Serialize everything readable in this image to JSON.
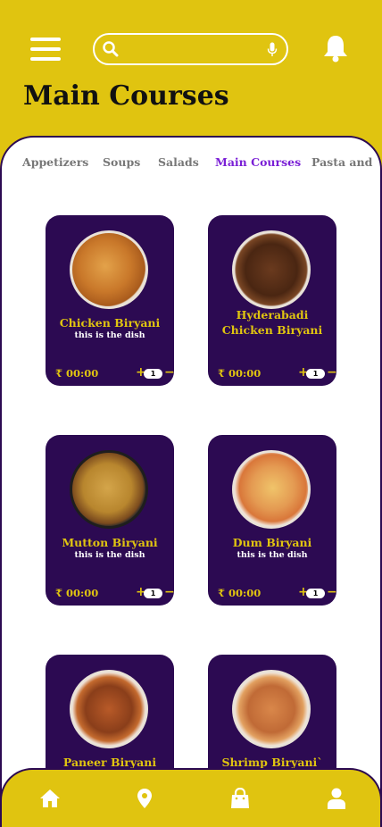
{
  "header": {
    "title": "Main Courses",
    "search_placeholder": ""
  },
  "icons": {
    "menu": "menu-icon",
    "search": "search-icon",
    "mic": "mic-icon",
    "bell": "bell-icon",
    "home": "home-icon",
    "location": "location-pin-icon",
    "cart": "shopping-bag-icon",
    "profile": "user-icon"
  },
  "tabs": [
    {
      "label": "Appetizers",
      "active": false
    },
    {
      "label": "Soups",
      "active": false
    },
    {
      "label": "Salads",
      "active": false
    },
    {
      "label": "Main Courses",
      "active": true
    },
    {
      "label": "Pasta and N",
      "active": false
    }
  ],
  "dishes": [
    {
      "name": "Chicken Biryani",
      "description": "this is the dish",
      "price": "₹ 00:00",
      "quantity": "1",
      "plus": "+",
      "minus": "−"
    },
    {
      "name": "Hyderabadi Chicken Biryani",
      "description": "",
      "price": "₹ 00:00",
      "quantity": "1",
      "plus": "+",
      "minus": "−"
    },
    {
      "name": "Mutton Biryani",
      "description": "this is the dish",
      "price": "₹ 00:00",
      "quantity": "1",
      "plus": "+",
      "minus": "−"
    },
    {
      "name": "Dum Biryani",
      "description": "this is the dish",
      "price": "₹ 00:00",
      "quantity": "1",
      "plus": "+",
      "minus": "−"
    },
    {
      "name": "Paneer Biryani",
      "description": "",
      "price": "",
      "quantity": "",
      "plus": "",
      "minus": ""
    },
    {
      "name": "Shrimp Biryani`",
      "description": "",
      "price": "",
      "quantity": "",
      "plus": "",
      "minus": ""
    }
  ],
  "colors": {
    "accent": "#e0c410",
    "brand": "#2c0a52",
    "active_tab": "#7a1fd6"
  }
}
